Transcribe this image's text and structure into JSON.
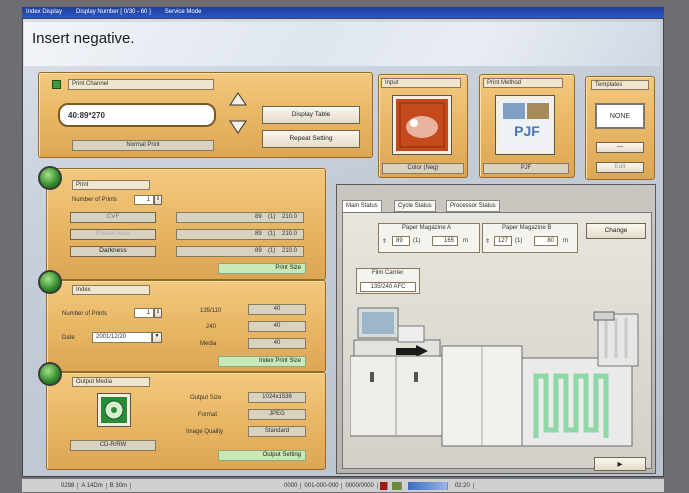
{
  "window": {
    "title_segments": [
      "Index Display",
      "Display Number [ 0/30 - 60 ]",
      "Service Mode"
    ]
  },
  "header": {
    "title": "Insert negative."
  },
  "order": {
    "channel_label": "Print Channel",
    "channel_value": "40:89*270",
    "normal_print": "Normal Print",
    "display_table": "Display Table",
    "repeat_setting": "Repeat Setting"
  },
  "input": {
    "title": "Input",
    "caption": "Color (Neg)"
  },
  "print_method": {
    "title": "Print Method",
    "caption": "PJF",
    "image_text": "PJF"
  },
  "templates": {
    "title": "Templates",
    "value": "NONE",
    "dash": "---",
    "edit": "Edit"
  },
  "print_section": {
    "title": "Print",
    "num_prints_label": "Number of Prints",
    "num_prints_value": "1",
    "buttons": [
      "CVF",
      "Preset Area",
      "Darkness"
    ],
    "rows": [
      [
        "89",
        "(1)",
        "210.0"
      ],
      [
        "89",
        "(1)",
        "210.0"
      ],
      [
        "89",
        "(1)",
        "210.0"
      ]
    ],
    "size_label": "Print Size"
  },
  "index_section": {
    "title": "Index",
    "num_prints_label": "Number of Prints",
    "num_prints_value": "1",
    "date_label": "Date",
    "date_value": "2001/12/20",
    "rows": [
      {
        "label": "135/110",
        "value": "40"
      },
      {
        "label": "240",
        "value": "40"
      },
      {
        "label": "Media",
        "value": "40"
      }
    ],
    "size_label": "Index Print Size"
  },
  "output_section": {
    "title": "Output Media",
    "media": "CD-R/RW",
    "rows": [
      {
        "label": "Output Size",
        "value": "1024x1536"
      },
      {
        "label": "Format",
        "value": "JPEG"
      },
      {
        "label": "Image Quality",
        "value": "Standard"
      }
    ],
    "setting_label": "Output Setting"
  },
  "tabs": [
    "Main Status",
    "Cycle Status",
    "Processor Status"
  ],
  "status": {
    "mag_a": {
      "title": "Paper Magazine A",
      "values": [
        "89",
        "(1)",
        "165"
      ],
      "unit": "m"
    },
    "mag_b": {
      "title": "Paper Magazine B",
      "values": [
        "127",
        "(1)",
        "80"
      ],
      "unit": "m"
    },
    "change": "Change",
    "film_carrier_title": "Film Carrier",
    "film_carrier_value": "135/240 AFC"
  },
  "footer_button": "▶",
  "statusbar": {
    "segments": [
      "0298",
      "A 14Dm",
      "B 30m",
      "0000",
      "001-000-000",
      "0000/0000",
      "",
      "",
      "",
      "02:20"
    ]
  },
  "colors": {
    "panel": "#e8b765",
    "accent_blue": "#2b57c4",
    "green_orb": "#2f8a2a"
  }
}
